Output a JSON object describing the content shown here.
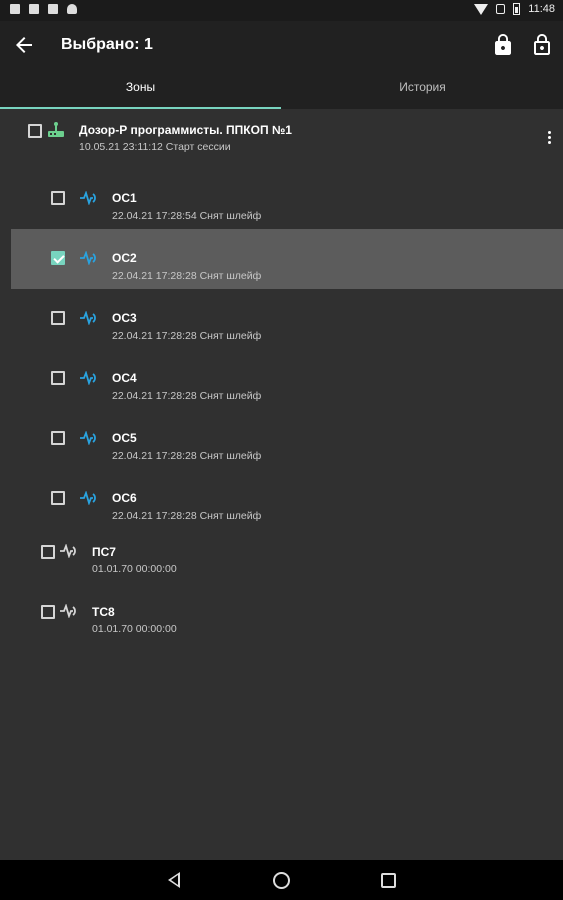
{
  "status_bar": {
    "time": "11:48",
    "icons": [
      "screenshot-icon",
      "notification-icon",
      "cast-icon",
      "android-icon",
      "wifi-icon",
      "mute-icon",
      "battery-icon"
    ]
  },
  "app_bar": {
    "title": "Выбрано: 1",
    "icons": [
      "back-arrow-icon",
      "lock-icon",
      "unlock-icon"
    ]
  },
  "tabs": [
    {
      "label": "Зоны",
      "active": true
    },
    {
      "label": "История",
      "active": false
    }
  ],
  "colors": {
    "accent": "#78d4bf",
    "zone_icon_blue": "#29a3e0",
    "device_icon_green": "#6ccf8e",
    "background": "#303030",
    "app_bar": "#212121",
    "selected_row": "#5c5c5c"
  },
  "device": {
    "name": "Дозор-Р программисты. ППКОП №1",
    "status": "10.05.21 23:11:12 Старт сессии",
    "checked": false,
    "icon": "router-icon"
  },
  "zones": [
    {
      "name": "ОС1",
      "status": "22.04.21 17:28:54 Снят шлейф",
      "checked": false,
      "icon": "zone-signal-icon"
    },
    {
      "name": "ОС2",
      "status": "22.04.21 17:28:28 Снят шлейф",
      "checked": true,
      "icon": "zone-signal-icon"
    },
    {
      "name": "ОС3",
      "status": "22.04.21 17:28:28 Снят шлейф",
      "checked": false,
      "icon": "zone-signal-icon"
    },
    {
      "name": "ОС4",
      "status": "22.04.21 17:28:28 Снят шлейф",
      "checked": false,
      "icon": "zone-signal-icon"
    },
    {
      "name": "ОС5",
      "status": "22.04.21 17:28:28 Снят шлейф",
      "checked": false,
      "icon": "zone-signal-icon"
    },
    {
      "name": "ОС6",
      "status": "22.04.21 17:28:28 Снят шлейф",
      "checked": false,
      "icon": "zone-signal-icon"
    },
    {
      "name": "ПС7",
      "status": "01.01.70 00:00:00",
      "checked": false,
      "icon": "zone-signal-icon"
    },
    {
      "name": "ТС8",
      "status": "01.01.70 00:00:00",
      "checked": false,
      "icon": "zone-signal-icon"
    }
  ],
  "nav_bar": {
    "icons": [
      "nav-back-icon",
      "nav-home-icon",
      "nav-recent-icon"
    ]
  }
}
